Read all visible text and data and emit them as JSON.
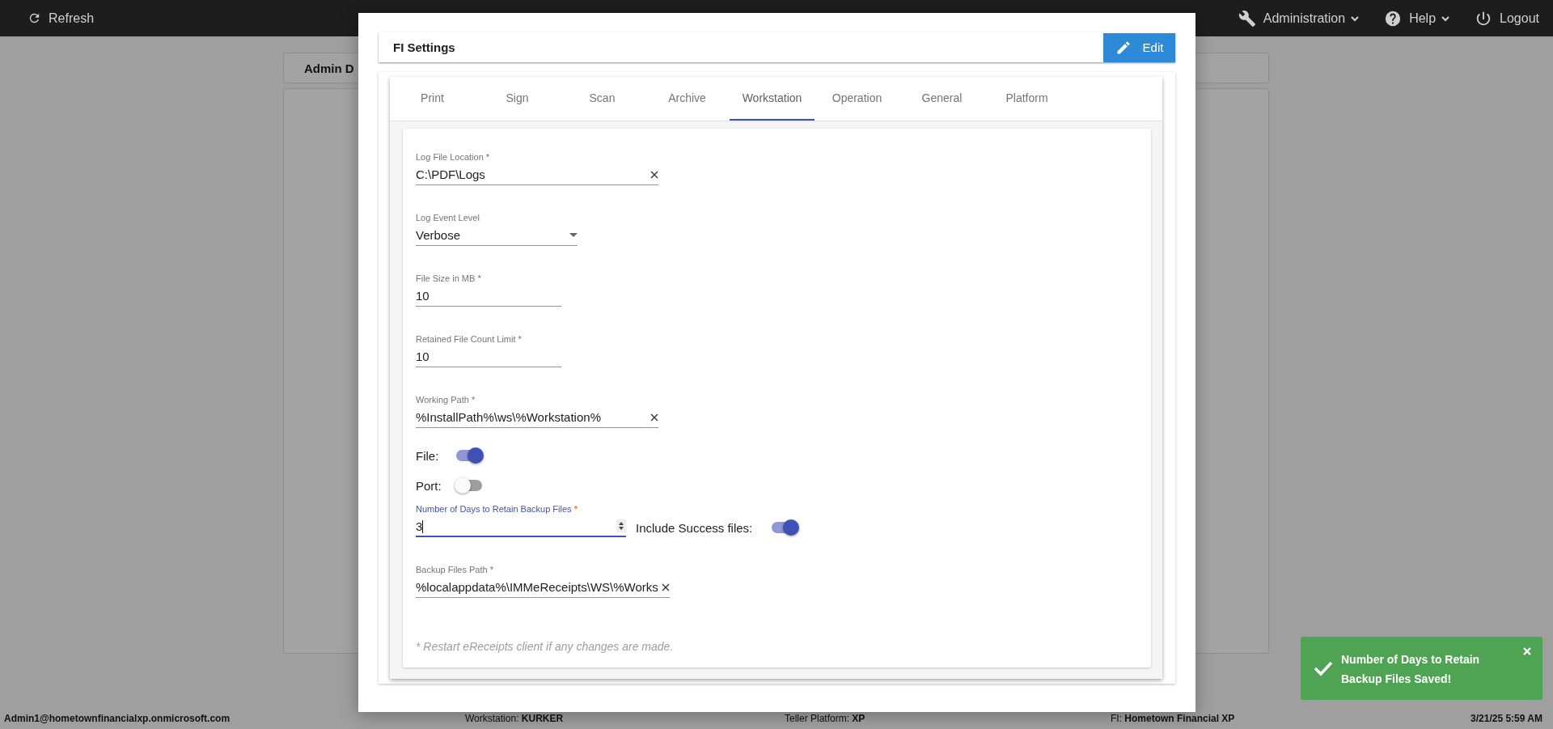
{
  "top_bar": {
    "refresh": "Refresh",
    "menus": [
      {
        "label": "Administration",
        "kind": "wrench",
        "dropdown": true
      },
      {
        "label": "Help",
        "kind": "help",
        "dropdown": true
      },
      {
        "label": "Logout",
        "kind": "power",
        "dropdown": false
      }
    ]
  },
  "background_panel": {
    "title": "Admin D"
  },
  "dialog": {
    "title": "FI Settings",
    "edit_button": "Edit",
    "tabs": [
      {
        "label": "Print",
        "selected": false
      },
      {
        "label": "Sign",
        "selected": false
      },
      {
        "label": "Scan",
        "selected": false
      },
      {
        "label": "Archive",
        "selected": false
      },
      {
        "label": "Workstation",
        "selected": true
      },
      {
        "label": "Operation",
        "selected": false
      },
      {
        "label": "General",
        "selected": false
      },
      {
        "label": "Platform",
        "selected": false
      }
    ],
    "fields": [
      {
        "kind": "text",
        "label": "Log File Location",
        "required_mark": "*",
        "value": "C:\\PDF\\Logs",
        "focused": false
      },
      {
        "kind": "select",
        "label": "Log Event Level",
        "value": "Verbose",
        "focused": false
      },
      {
        "kind": "number",
        "label": "File Size in MB",
        "required_mark": "*",
        "value": "10",
        "focused": false
      },
      {
        "kind": "number",
        "label": "Retained File Count Limit",
        "required_mark": "*",
        "value": "10",
        "focused": false
      },
      {
        "kind": "text",
        "label": "Working Path",
        "required_mark": "*",
        "value": "%InstallPath%\\ws\\%Workstation%",
        "focused": false
      },
      {
        "kind": "toggle",
        "label": "File:",
        "on": true
      },
      {
        "kind": "toggle",
        "label": "Port:",
        "on": false
      },
      {
        "kind": "spin",
        "label": "Number of Days to Retain Backup Files",
        "required_mark": "*",
        "value": "3",
        "focused": true,
        "inline_toggle": {
          "label": "Include Success files:",
          "on": true
        }
      },
      {
        "kind": "text",
        "label": "Backup Files Path",
        "required_mark": "*",
        "value": "%localappdata%\\IMMeReceipts\\WS\\%Works",
        "focused": false
      }
    ],
    "note": "* Restart eReceipts client if any changes are made."
  },
  "status_bar": [
    {
      "value": "Admin1@hometownfinancialxp.onmicrosoft.com"
    },
    {
      "label": "Workstation:",
      "value": "KURKER"
    },
    {
      "label": "Teller Platform:",
      "value": "XP"
    },
    {
      "label": "FI:",
      "value": "Hometown Financial XP"
    },
    {
      "value": "3/21/25 5:59 AM"
    }
  ],
  "toast": {
    "message": "Number of Days to Retain Backup Files Saved!"
  }
}
